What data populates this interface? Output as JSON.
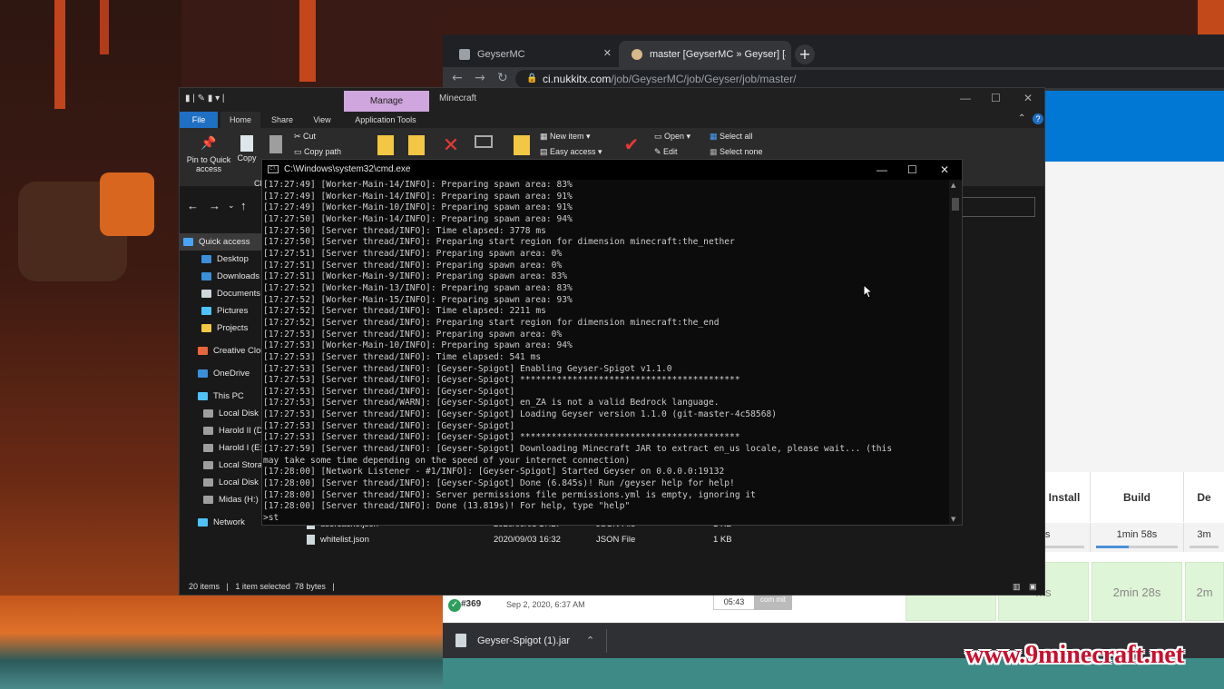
{
  "browser": {
    "tabs": [
      {
        "label": "GeyserMC",
        "active": false
      },
      {
        "label": "master [GeyserMC » Geyser] [Jen",
        "active": true
      }
    ],
    "new_tab": "+",
    "tab_close": "✕",
    "url_host": "ci.nukkitx.com",
    "url_path": "/job/GeyserMC/job/Geyser/job/master/",
    "stages": [
      {
        "header": "reative: Install",
        "avg": "ms",
        "cell": "ms"
      },
      {
        "header": "Build",
        "avg": "1min 58s",
        "cell": "2min 28s"
      },
      {
        "header": "De",
        "avg": "3m",
        "cell": "2m"
      }
    ],
    "build": {
      "number": "#369",
      "date": "Sep 2, 2020, 6:37 AM",
      "time": "05:43",
      "commits": "com mit"
    },
    "download": {
      "file": "Geyser-Spigot (1).jar"
    }
  },
  "explorer": {
    "manage_label": "Manage",
    "app_name": "Minecraft",
    "ribbon_tabs": [
      "File",
      "Home",
      "Share",
      "View",
      "Application Tools"
    ],
    "ribbon": {
      "pin": "Pin to Quick access",
      "copy": "Copy",
      "cut": "Cut",
      "copy_path": "Copy path",
      "new_item": "New item",
      "easy_access": "Easy access",
      "open": "Open",
      "edit": "Edit",
      "select_all": "Select all",
      "select_none": "Select none",
      "clipboard_trunc": "Cl"
    },
    "sidebar": [
      {
        "label": "Quick access",
        "color": "#4aa3ff",
        "selected": true
      },
      {
        "label": "Desktop",
        "color": "#3b8fd9",
        "selected": false
      },
      {
        "label": "Downloads",
        "color": "#3b8fd9",
        "selected": false
      },
      {
        "label": "Documents",
        "color": "#cfd8dc",
        "selected": false
      },
      {
        "label": "Pictures",
        "color": "#4fc3f7",
        "selected": false
      },
      {
        "label": "Projects",
        "color": "#f2c744",
        "selected": false
      },
      {
        "label": "Creative Clou",
        "color": "#e8663d",
        "selected": false
      },
      {
        "label": "OneDrive",
        "color": "#3b8fd9",
        "selected": false
      },
      {
        "label": "This PC",
        "color": "#4fc3f7",
        "selected": false
      },
      {
        "label": "Local Disk (",
        "color": "#9e9e9e",
        "selected": false
      },
      {
        "label": "Harold II (D",
        "color": "#9e9e9e",
        "selected": false
      },
      {
        "label": "Harold I (E:)",
        "color": "#9e9e9e",
        "selected": false
      },
      {
        "label": "Local Storag",
        "color": "#9e9e9e",
        "selected": false
      },
      {
        "label": "Local Disk (",
        "color": "#9e9e9e",
        "selected": false
      },
      {
        "label": "Midas (H:)",
        "color": "#9e9e9e",
        "selected": false
      },
      {
        "label": "Network",
        "color": "#4fc3f7",
        "selected": false
      }
    ],
    "files": [
      {
        "name": "usercache.json",
        "date": "2020/09/03 17:27",
        "type": "JSON File",
        "size": "1 KB"
      },
      {
        "name": "whitelist.json",
        "date": "2020/09/03 16:32",
        "type": "JSON File",
        "size": "1 KB"
      }
    ],
    "status": "20 items   |   1 item selected  78 bytes   |"
  },
  "cmd": {
    "title": "C:\\Windows\\system32\\cmd.exe",
    "icon_text": "C:\\",
    "lines": [
      "[17:27:49] [Worker-Main-14/INFO]: Preparing spawn area: 83%",
      "[17:27:49] [Worker-Main-14/INFO]: Preparing spawn area: 91%",
      "[17:27:49] [Worker-Main-10/INFO]: Preparing spawn area: 91%",
      "[17:27:50] [Worker-Main-14/INFO]: Preparing spawn area: 94%",
      "[17:27:50] [Server thread/INFO]: Time elapsed: 3778 ms",
      "[17:27:50] [Server thread/INFO]: Preparing start region for dimension minecraft:the_nether",
      "[17:27:51] [Server thread/INFO]: Preparing spawn area: 0%",
      "[17:27:51] [Server thread/INFO]: Preparing spawn area: 0%",
      "[17:27:51] [Worker-Main-9/INFO]: Preparing spawn area: 83%",
      "[17:27:52] [Worker-Main-13/INFO]: Preparing spawn area: 83%",
      "[17:27:52] [Worker-Main-15/INFO]: Preparing spawn area: 93%",
      "[17:27:52] [Server thread/INFO]: Time elapsed: 2211 ms",
      "[17:27:52] [Server thread/INFO]: Preparing start region for dimension minecraft:the_end",
      "[17:27:53] [Server thread/INFO]: Preparing spawn area: 0%",
      "[17:27:53] [Worker-Main-10/INFO]: Preparing spawn area: 94%",
      "[17:27:53] [Server thread/INFO]: Time elapsed: 541 ms",
      "[17:27:53] [Server thread/INFO]: [Geyser-Spigot] Enabling Geyser-Spigot v1.1.0",
      "[17:27:53] [Server thread/INFO]: [Geyser-Spigot] ******************************************",
      "[17:27:53] [Server thread/INFO]: [Geyser-Spigot]",
      "[17:27:53] [Server thread/WARN]: [Geyser-Spigot] en_ZA is not a valid Bedrock language.",
      "[17:27:53] [Server thread/INFO]: [Geyser-Spigot] Loading Geyser version 1.1.0 (git-master-4c58568)",
      "[17:27:53] [Server thread/INFO]: [Geyser-Spigot]",
      "[17:27:53] [Server thread/INFO]: [Geyser-Spigot] ******************************************",
      "[17:27:59] [Server thread/INFO]: [Geyser-Spigot] Downloading Minecraft JAR to extract en_us locale, please wait... (this",
      "may take some time depending on the speed of your internet connection)",
      "[17:28:00] [Network Listener - #1/INFO]: [Geyser-Spigot] Started Geyser on 0.0.0.0:19132",
      "[17:28:00] [Server thread/INFO]: [Geyser-Spigot] Done (6.845s)! Run /geyser help for help!",
      "[17:28:00] [Server thread/INFO]: Server permissions file permissions.yml is empty, ignoring it",
      "[17:28:00] [Server thread/INFO]: Done (13.819s)! For help, type \"help\"",
      ">st"
    ]
  },
  "watermark": "www.9minecraft.net"
}
